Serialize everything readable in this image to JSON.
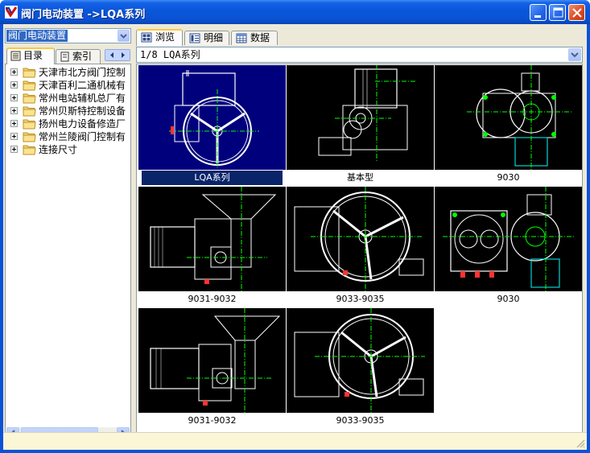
{
  "window": {
    "title": "阀门电动装置 ->LQA系列",
    "accent_color": "#0a52d8"
  },
  "left_panel": {
    "combo_value": "阀门电动装置",
    "tabs": [
      {
        "label": "目录",
        "active": true
      },
      {
        "label": "索引",
        "active": false
      }
    ],
    "tree_items": [
      {
        "label": "天津市北方阀门控制"
      },
      {
        "label": "天津百利二通机械有"
      },
      {
        "label": "常州电站辅机总厂有"
      },
      {
        "label": "常州贝斯特控制设备"
      },
      {
        "label": "扬州电力设备修造厂"
      },
      {
        "label": "常州兰陵阀门控制有"
      },
      {
        "label": "连接尺寸"
      }
    ]
  },
  "right_panel": {
    "tabs": [
      {
        "label": "浏览",
        "active": true
      },
      {
        "label": "明细",
        "active": false
      },
      {
        "label": "数据",
        "active": false
      }
    ],
    "path_value": "1/8 LQA系列",
    "thumbnails": [
      {
        "caption": "LQA系列",
        "selected": true
      },
      {
        "caption": "基本型",
        "selected": false
      },
      {
        "caption": "9030",
        "selected": false
      },
      {
        "caption": "9031-9032",
        "selected": false
      },
      {
        "caption": "9033-9035",
        "selected": false
      },
      {
        "caption": "9030",
        "selected": false
      },
      {
        "caption": "9031-9032",
        "selected": false
      },
      {
        "caption": "9033-9035",
        "selected": false
      }
    ]
  },
  "status": {
    "text": ""
  }
}
